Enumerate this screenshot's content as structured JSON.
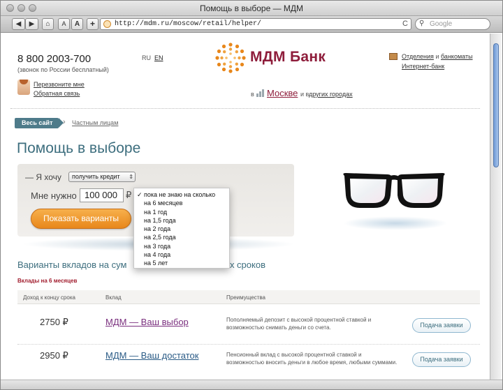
{
  "window": {
    "title": "Помощь в выборе — МДМ"
  },
  "toolbar": {
    "back_label": "◀",
    "forward_label": "▶",
    "home_label": "⌂",
    "text_smaller_label": "A",
    "text_larger_label": "A",
    "add_label": "+",
    "url": "http://mdm.ru/moscow/retail/helper/",
    "reload_label": "C",
    "search_placeholder": "Google"
  },
  "header": {
    "phone": "8 800 2003-700",
    "phone_note": "(звонок по России бесплатный)",
    "lang_ru": "RU",
    "lang_en": "EN",
    "logo_text": "МДМ Банк",
    "branches_link": "Отделения",
    "and_word": "и",
    "atms_link": "банкоматы",
    "internet_bank_link": "Интернет-банк",
    "callback_link": "Перезвоните мне",
    "feedback_link": "Обратная связь",
    "city_prefix": "в",
    "city_main": "Москве",
    "city_mid": "и в",
    "city_other": "других городах"
  },
  "breadcrumb": {
    "all_site": "Весь сайт",
    "arrow": "›",
    "private": "Частным лицам"
  },
  "main": {
    "title": "Помощь в выборе",
    "want_label": "— Я хочу",
    "want_value": "получить кредит",
    "need_label": "Мне нужно",
    "amount_value": "100 000",
    "currency": "₽",
    "show_button": "Показать варианты",
    "dropdown_options": [
      "пока не знаю на сколько",
      "на 6 месяцев",
      "на 1 год",
      "на 1,5 года",
      "на 2 года",
      "на 2,5 года",
      "на 3 года",
      "на 4 года",
      "на 5 лет"
    ],
    "results_title_left": "Варианты вкладов на сум",
    "results_title_right": "ных сроков",
    "results_subtitle": "Вклады на 6 месяцев",
    "table": {
      "headers": [
        "Доход к концу срока",
        "Вклад",
        "Преимущества"
      ],
      "rows": [
        {
          "amount": "2750 ₽",
          "name": "МДМ — Ваш выбор",
          "desc": "Пополняемый депозит с высокой процентной ставкой и возможностью снимать деньги со счета.",
          "button": "Подача заявки"
        },
        {
          "amount": "2950 ₽",
          "name": "МДМ — Ваш достаток",
          "desc": "Пенсионный вклад с высокой процентной ставкой и возможностью вносить деньги в любое время, любыми суммами.",
          "button": "Подача заявки"
        }
      ]
    }
  },
  "colors": {
    "brand": "#8e1d3b",
    "accent_orange": "#e8871b",
    "heading_teal": "#3d6e7e",
    "link_purple": "#7a2f7e",
    "link_blue": "#2a5b86"
  },
  "icons": {
    "logo": "sunburst-logo-icon",
    "glasses": "glasses-icon",
    "avatar": "operator-avatar-icon",
    "search": "magnifier-icon",
    "globe": "globe-icon"
  }
}
